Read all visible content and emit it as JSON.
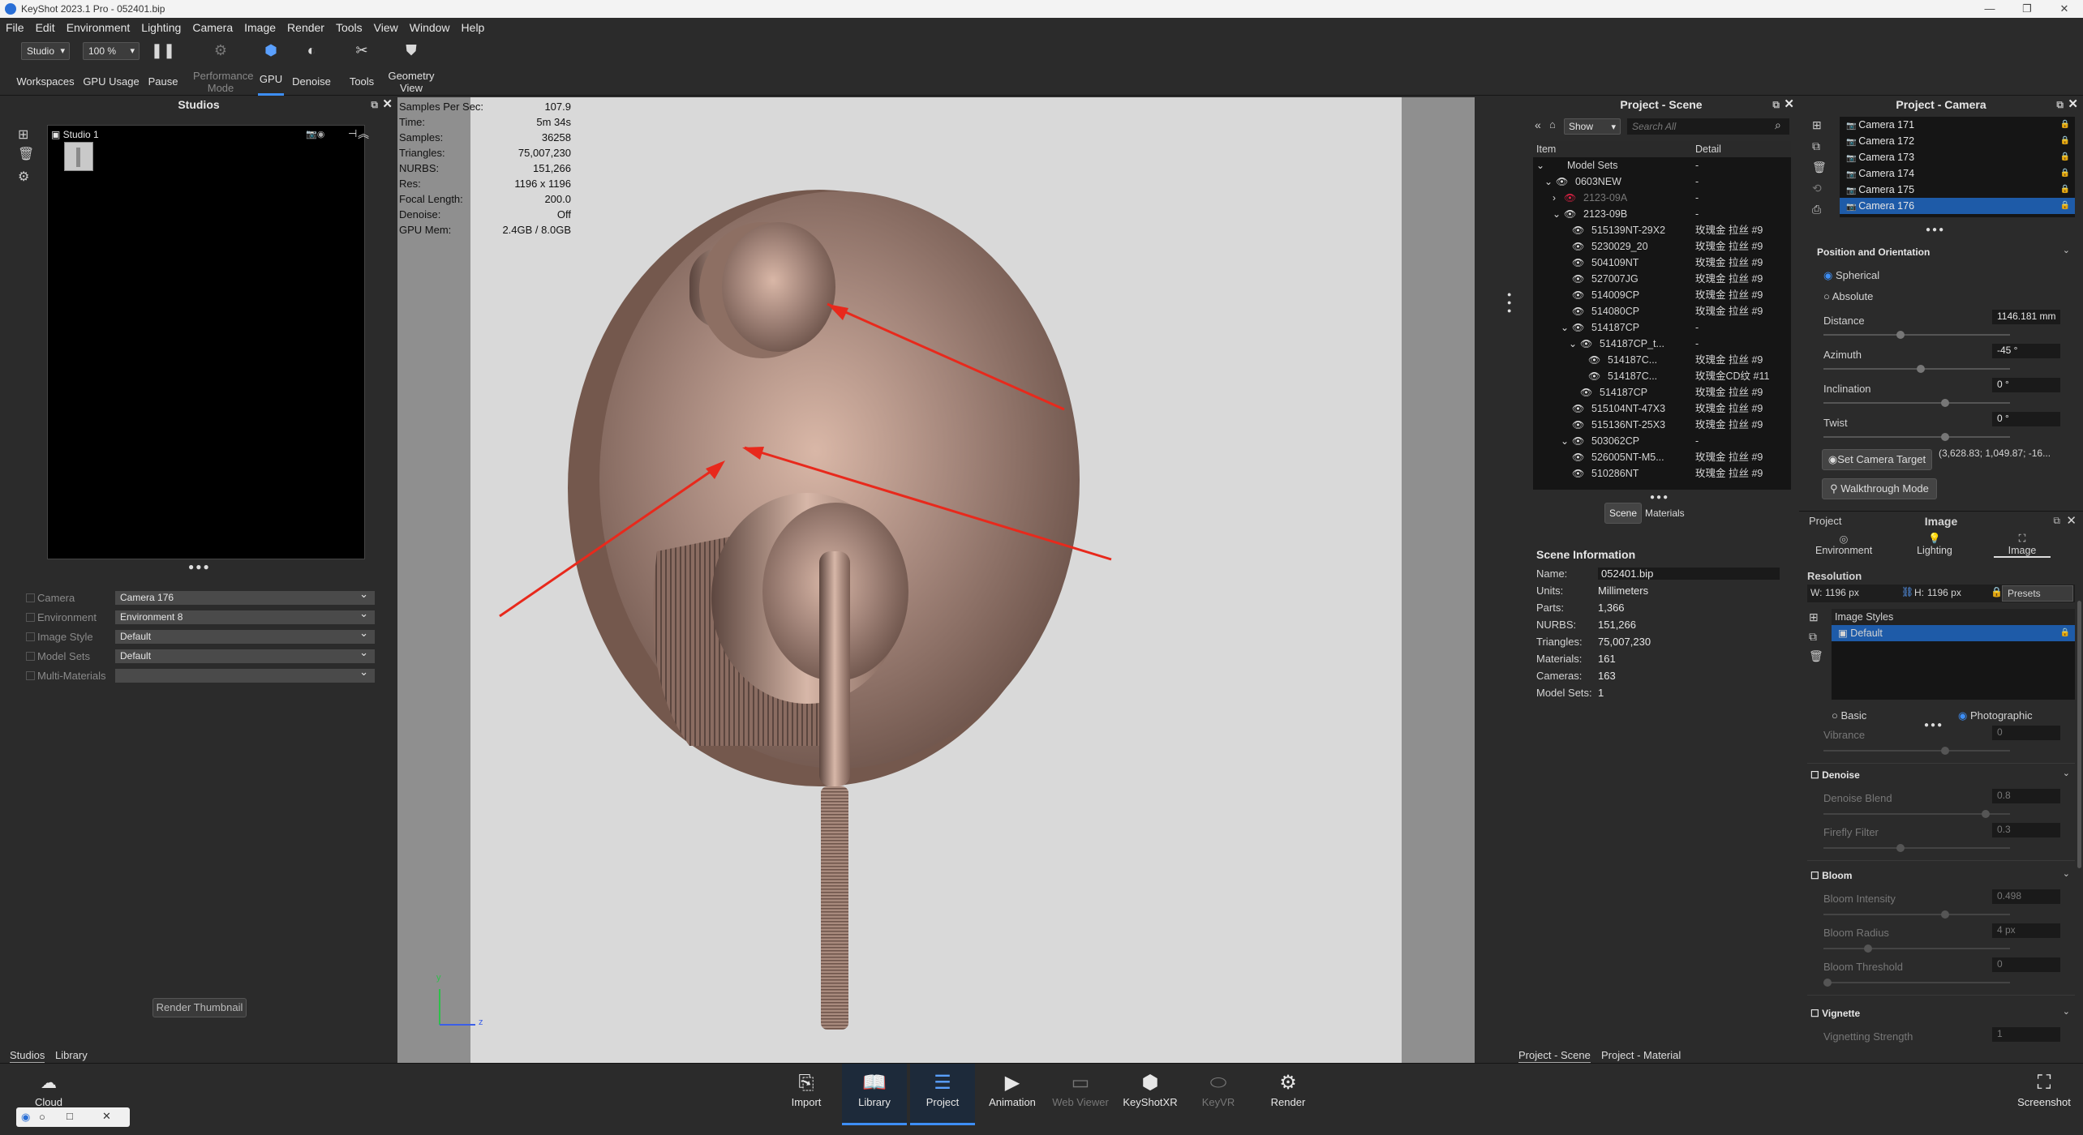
{
  "window": {
    "title": "KeyShot 2023.1 Pro  - 052401.bip",
    "controls": [
      "—",
      "❐",
      "✕"
    ]
  },
  "menu": [
    "File",
    "Edit",
    "Environment",
    "Lighting",
    "Camera",
    "Image",
    "Render",
    "Tools",
    "View",
    "Window",
    "Help"
  ],
  "toolbar": {
    "workspace_value": "Studio",
    "workspace_label": "Workspaces",
    "gpu_usage_value": "100 %",
    "gpu_usage_label": "GPU Usage",
    "pause": "Pause",
    "performance": "Performance Mode",
    "gpu": "GPU",
    "denoise": "Denoise",
    "tools": "Tools",
    "geometry": "Geometry View"
  },
  "studios": {
    "title": "Studios",
    "studio_name": "Studio 1",
    "fields": [
      {
        "label": "Camera",
        "value": "Camera 176"
      },
      {
        "label": "Environment",
        "value": "Environment 8"
      },
      {
        "label": "Image Style",
        "value": "Default"
      },
      {
        "label": "Model Sets",
        "value": "Default"
      },
      {
        "label": "Multi-Materials",
        "value": ""
      }
    ],
    "render_thumb": "Render Thumbnail",
    "tabs": [
      "Studios",
      "Library"
    ]
  },
  "stats": [
    [
      "Samples Per Sec:",
      "107.9"
    ],
    [
      "Time:",
      "5m 34s"
    ],
    [
      "Samples:",
      "36258"
    ],
    [
      "Triangles:",
      "75,007,230"
    ],
    [
      "NURBS:",
      "151,266"
    ],
    [
      "Res:",
      "1196 x 1196"
    ],
    [
      "Focal Length:",
      "200.0"
    ],
    [
      "Denoise:",
      "Off"
    ],
    [
      "GPU Mem:",
      "2.4GB / 8.0GB"
    ]
  ],
  "axes": {
    "y": "y",
    "z": "z"
  },
  "scene": {
    "title": "Project - Scene",
    "show": "Show",
    "search_placeholder": "Search All",
    "col_item": "Item",
    "col_detail": "Detail",
    "rows": [
      {
        "name": "Model Sets",
        "detail": "-",
        "indent": 0,
        "eye": 0,
        "dim": false
      },
      {
        "name": "0603NEW",
        "detail": "-",
        "indent": 1,
        "eye": 1,
        "dim": false
      },
      {
        "name": "2123-09A",
        "detail": "-",
        "indent": 2,
        "eye": 2,
        "dim": true
      },
      {
        "name": "2123-09B",
        "detail": "-",
        "indent": 2,
        "eye": 1,
        "dim": false
      },
      {
        "name": "515139NT-29X2",
        "detail": "玫瑰金 拉丝 #9",
        "indent": 3,
        "eye": 1,
        "dim": false
      },
      {
        "name": "5230029_20",
        "detail": "玫瑰金 拉丝 #9",
        "indent": 3,
        "eye": 1,
        "dim": false
      },
      {
        "name": "504109NT",
        "detail": "玫瑰金 拉丝 #9",
        "indent": 3,
        "eye": 1,
        "dim": false
      },
      {
        "name": "527007JG",
        "detail": "玫瑰金 拉丝 #9",
        "indent": 3,
        "eye": 1,
        "dim": false
      },
      {
        "name": "514009CP",
        "detail": "玫瑰金 拉丝 #9",
        "indent": 3,
        "eye": 1,
        "dim": false
      },
      {
        "name": "514080CP",
        "detail": "玫瑰金 拉丝 #9",
        "indent": 3,
        "eye": 1,
        "dim": false
      },
      {
        "name": "514187CP",
        "detail": "-",
        "indent": 3,
        "eye": 1,
        "dim": false
      },
      {
        "name": "514187CP_t...",
        "detail": "-",
        "indent": 4,
        "eye": 1,
        "dim": false
      },
      {
        "name": "514187C...",
        "detail": "玫瑰金 拉丝 #9",
        "indent": 5,
        "eye": 1,
        "dim": false
      },
      {
        "name": "514187C...",
        "detail": "玫瑰金CD纹 #11",
        "indent": 5,
        "eye": 1,
        "dim": false
      },
      {
        "name": "514187CP",
        "detail": "玫瑰金 拉丝 #9",
        "indent": 4,
        "eye": 1,
        "dim": false
      },
      {
        "name": "515104NT-47X3",
        "detail": "玫瑰金 拉丝 #9",
        "indent": 3,
        "eye": 1,
        "dim": false
      },
      {
        "name": "515136NT-25X3",
        "detail": "玫瑰金 拉丝 #9",
        "indent": 3,
        "eye": 1,
        "dim": false
      },
      {
        "name": "503062CP",
        "detail": "-",
        "indent": 3,
        "eye": 1,
        "dim": false
      },
      {
        "name": "526005NT-M5...",
        "detail": "玫瑰金 拉丝 #9",
        "indent": 3,
        "eye": 1,
        "dim": false
      },
      {
        "name": "510286NT",
        "detail": "玫瑰金 拉丝 #9",
        "indent": 3,
        "eye": 1,
        "dim": false
      }
    ],
    "tab_scene": "Scene",
    "tab_materials": "Materials",
    "info_title": "Scene Information",
    "info": [
      [
        "Name:",
        "052401.bip"
      ],
      [
        "Units:",
        "Millimeters"
      ],
      [
        "Parts:",
        "1,366"
      ],
      [
        "NURBS:",
        "151,266"
      ],
      [
        "Triangles:",
        "75,007,230"
      ],
      [
        "Materials:",
        "161"
      ],
      [
        "Cameras:",
        "163"
      ],
      [
        "Model Sets:",
        "1"
      ]
    ],
    "bottom_tabs": [
      "Project - Scene",
      "Project - Material"
    ]
  },
  "camera": {
    "title": "Project - Camera",
    "list": [
      "Camera 171",
      "Camera 172",
      "Camera 173",
      "Camera 174",
      "Camera 175",
      "Camera 176"
    ],
    "pos_title": "Position and Orientation",
    "spherical": "Spherical",
    "absolute": "Absolute",
    "distance_label": "Distance",
    "distance": "1146.181 mm",
    "azimuth_label": "Azimuth",
    "azimuth": "-45 °",
    "inclination_label": "Inclination",
    "inclination": "0 °",
    "twist_label": "Twist",
    "twist": "0 °",
    "set_target": "Set Camera Target",
    "target_coords": "(3,628.83; 1,049.87; -16...",
    "walkthrough": "Walkthrough Mode"
  },
  "image": {
    "project": "Project",
    "title": "Image",
    "tabs": [
      "Environment",
      "Lighting",
      "Image"
    ],
    "resolution": "Resolution",
    "w": "1196 px",
    "h": "1196 px",
    "w_label": "W:",
    "h_label": "H:",
    "presets": "Presets",
    "styles_title": "Image Styles",
    "style_default": "Default",
    "basic": "Basic",
    "photographic": "Photographic",
    "vibrance": "Vibrance",
    "vibrance_val": "0",
    "denoise": "Denoise",
    "denoise_blend": "Denoise Blend",
    "denoise_blend_val": "0.8",
    "firefly": "Firefly Filter",
    "firefly_val": "0.3",
    "bloom": "Bloom",
    "bloom_intensity": "Bloom Intensity",
    "bloom_intensity_val": "0.498",
    "bloom_radius": "Bloom Radius",
    "bloom_radius_val": "4 px",
    "bloom_threshold": "Bloom Threshold",
    "bloom_threshold_val": "0",
    "vignette": "Vignette",
    "vignette_strength": "Vignetting Strength",
    "vignette_strength_val": "1"
  },
  "bottom": {
    "cloud": "Cloud",
    "items": [
      "Import",
      "Library",
      "Project",
      "Animation",
      "Web Viewer",
      "KeyShotXR",
      "KeyVR",
      "Render"
    ],
    "screenshot": "Screenshot"
  },
  "colors": {
    "accent": "#1e5ba8",
    "arrow": "#e8291c",
    "render_bg": "#d9d9d9"
  }
}
